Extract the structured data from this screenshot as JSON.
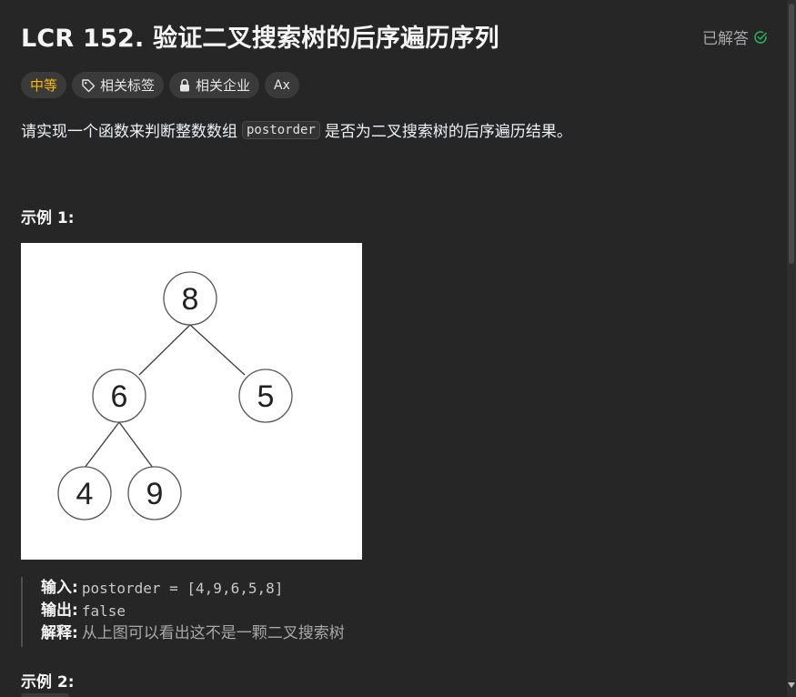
{
  "problem": {
    "title": "LCR 152. 验证二叉搜索树的后序遍历序列",
    "status": "已解答"
  },
  "tags": {
    "difficulty": "中等",
    "topics": "相关标签",
    "companies": "相关企业",
    "font_icon": "Ax"
  },
  "description": {
    "before": "请实现一个函数来判断整数数组",
    "code": "postorder",
    "after": "是否为二叉搜索树的后序遍历结果。"
  },
  "example1": {
    "heading": "示例 1:",
    "tree_nodes": [
      "8",
      "6",
      "5",
      "4",
      "9"
    ],
    "input_label": "输入:",
    "input_value": "postorder = [4,9,6,5,8]",
    "output_label": "输出:",
    "output_value": "false",
    "explain_label": "解释:",
    "explain_value": "从上图可以看出这不是一颗二叉搜索树"
  },
  "example2": {
    "heading": "示例 2:"
  },
  "colors": {
    "background": "#262626",
    "difficulty_medium": "#ffb800",
    "solved_check": "#2db55d"
  },
  "icons": [
    "check-circle-icon",
    "tag-icon",
    "lock-icon",
    "font-size-icon"
  ]
}
